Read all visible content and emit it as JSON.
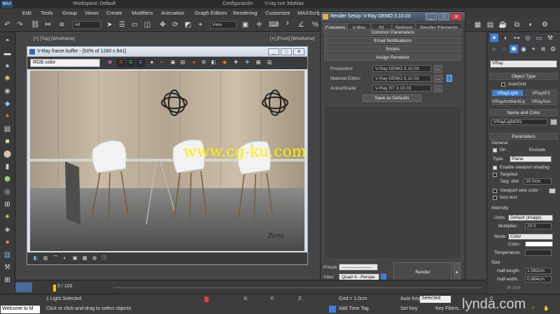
{
  "window": {
    "title": "Configuración",
    "title_right": "V-ray con 3dsMax",
    "workspace": "Workspace: Default"
  },
  "menu": [
    "Edit",
    "Tools",
    "Group",
    "Views",
    "Create",
    "Modifiers",
    "Animation",
    "Graph Editors",
    "Rendering",
    "Customize",
    "MAXScript"
  ],
  "toolbar": {
    "filter": "All",
    "view": "View"
  },
  "viewports": {
    "top_label": "[+] [Top] [Wireframe]",
    "front_label": "[+] [Front] [Wireframe]"
  },
  "frame_buffer": {
    "title": "V-Ray frame buffer - [50% of 1280 x 841]",
    "channel": "RGB color",
    "buttons": {
      "r": "R",
      "g": "G",
      "b": "B"
    },
    "signature": "Zeno"
  },
  "watermark": "www.cg-ku.com",
  "render_setup": {
    "title": "Render Setup: V-Ray DEMO 3.10.03",
    "tabs": [
      "Common",
      "V-Ray",
      "GI",
      "Settings",
      "Render Elements"
    ],
    "rollouts": [
      "Common Parameters",
      "Email Notifications",
      "Scripts",
      "Assign Renderer"
    ],
    "rows": [
      {
        "label": "Production:",
        "value": "V-Ray DEMO 3.10.03"
      },
      {
        "label": "Material Editor:",
        "value": "V-Ray DEMO 3.10.03"
      },
      {
        "label": "ActiveShade:",
        "value": "V-Ray RT 3.10.03"
      }
    ],
    "browse": "...",
    "save_defaults": "Save as Defaults",
    "preset_label": "Preset:",
    "preset_value": "--------------------",
    "view_label": "View:",
    "view_value": "Quad 4 - Perspe",
    "render": "Render"
  },
  "command_panel": {
    "category": "VRay",
    "object_type": "Object Type",
    "autogrid": "AutoGrid",
    "types": [
      "VRayLight",
      "VRayIES",
      "VRayAmbientLig",
      "VRaySun"
    ],
    "name_and_color": "Name and Color",
    "name": "VRayLight001",
    "parameters": "Parameters",
    "general": "General",
    "on": "On",
    "exclude": "Exclude",
    "type_label": "Type:",
    "type_value": "Plane",
    "enable_viewport_shading": "Enable viewport shading",
    "targeted": "Targeted",
    "targ_dist_label": "Targ. dist:",
    "targ_dist_value": "20.0cm",
    "viewport_wire_color": "Viewport wire color",
    "icon_text": "Icon text",
    "intensity": "Intensity",
    "units_label": "Units:",
    "units_value": "Default (image)",
    "multiplier_label": "Multiplier:",
    "multiplier_value": "20.0",
    "mode_label": "Mode:",
    "mode_value": "Color",
    "color_label": "Color:",
    "temperature_label": "Temperature:",
    "size": "Size",
    "half_length_label": "Half-length:",
    "half_length_value": "1.592cm",
    "half_width_label": "Half-width:",
    "half_width_value": "0.864cm",
    "w_size_label": "W size"
  },
  "timeline": {
    "frame": "0 / 100"
  },
  "status": {
    "maxscript": "Welcome to M",
    "selection": "1 Light Selected",
    "prompt": "Click or click-and-drag to select objects",
    "x": "X:",
    "y": "Y:",
    "z": "Z:",
    "grid": "Grid = 1.0cm",
    "add_time_tag": "Add Time Tag",
    "auto_key": "Auto Key",
    "auto_key_mode": "Selected",
    "set_key": "Set Key",
    "key_filters": "Key Filters...",
    "frame_value": "0",
    "brand": "lynda.com"
  }
}
